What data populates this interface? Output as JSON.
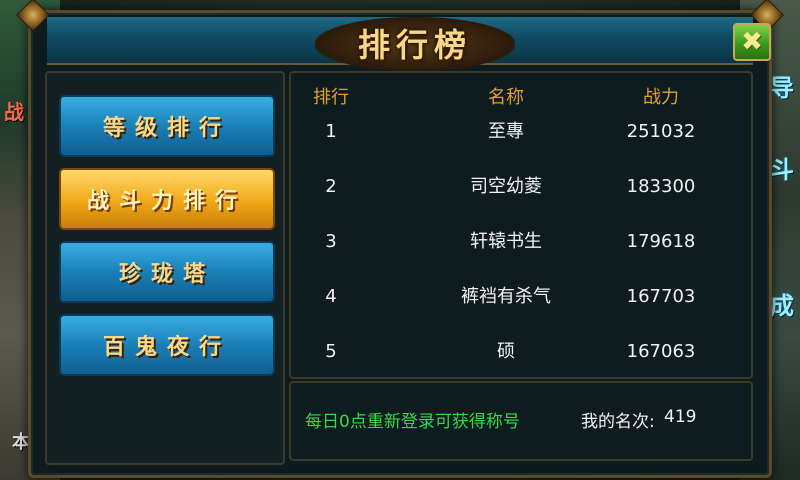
{
  "window": {
    "title": "排行榜"
  },
  "close_glyph": "✖",
  "tabs": [
    {
      "label": "等级排行",
      "active": false
    },
    {
      "label": "战斗力排行",
      "active": true
    },
    {
      "label": "珍珑塔",
      "active": false
    },
    {
      "label": "百鬼夜行",
      "active": false
    }
  ],
  "ranking": {
    "headers": {
      "rank": "排行",
      "name": "名称",
      "power": "战力"
    },
    "rows": [
      {
        "rank": "1",
        "name": "至專",
        "power": "251032"
      },
      {
        "rank": "2",
        "name": "司空幼菱",
        "power": "183300"
      },
      {
        "rank": "3",
        "name": "轩辕书生",
        "power": "179618"
      },
      {
        "rank": "4",
        "name": "裤裆有杀气",
        "power": "167703"
      },
      {
        "rank": "5",
        "name": "硕",
        "power": "167063"
      }
    ]
  },
  "footer": {
    "tip": "每日0点重新登录可获得称号",
    "my_rank_label": "我的名次:",
    "my_rank_value": "419"
  },
  "background": {
    "right_glyphs": [
      "导",
      "斗",
      "成"
    ],
    "left_glyphs": [
      "战",
      "本"
    ]
  },
  "colors": {
    "header_text": "#e0a030",
    "tip_text": "#36d84a",
    "active_tab": "#f0a818",
    "inactive_tab": "#1a80b8"
  }
}
